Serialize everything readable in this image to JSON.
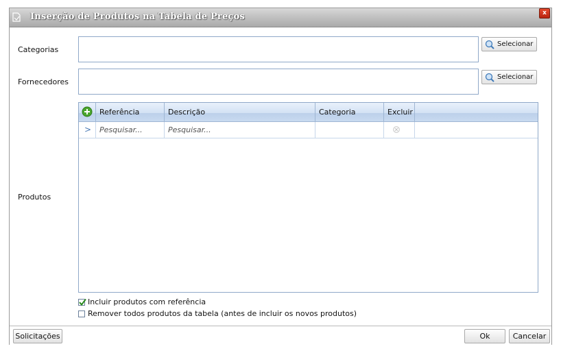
{
  "window": {
    "title": "Inserção de Produtos na Tabela de Preços",
    "close_label": "x"
  },
  "form": {
    "categorias_label": "Categorias",
    "fornecedores_label": "Fornecedores",
    "produtos_label": "Produtos",
    "select_button_label": "Selecionar",
    "categorias_value": "",
    "fornecedores_value": ""
  },
  "grid": {
    "columns": [
      "Referência",
      "Descrição",
      "Categoria",
      "Excluir"
    ],
    "search_placeholders": {
      "referencia": "Pesquisar...",
      "descricao": "Pesquisar..."
    },
    "row_indicator": ">"
  },
  "options": {
    "include_reference": {
      "label": "Incluir produtos com referência",
      "checked": true
    },
    "remove_all": {
      "label": "Remover todos produtos da tabela (antes de incluir os novos produtos)",
      "checked": false
    }
  },
  "footer": {
    "solicitacoes_label": "Solicitações",
    "ok_label": "Ok",
    "cancelar_label": "Cancelar"
  },
  "colors": {
    "grid_header": "#d3e2f4",
    "field_border": "#8fa8c8",
    "check_green": "#2a8a1e",
    "add_icon_green": "#4aa52e"
  },
  "icons": {
    "title": "document-icon",
    "add": "plus-circle-icon",
    "search": "magnifier-icon",
    "delete": "x-circle-icon",
    "close": "close-icon"
  }
}
